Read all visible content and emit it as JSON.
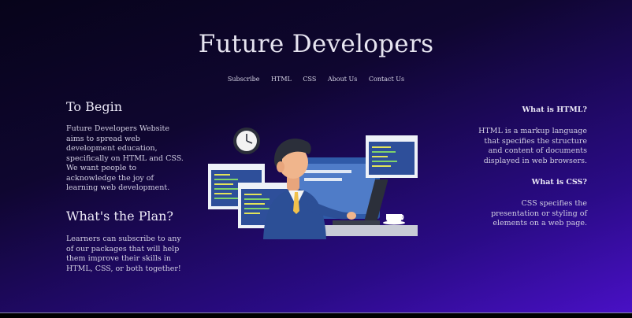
{
  "header": {
    "title": "Future Developers"
  },
  "nav": {
    "items": [
      "Subscribe",
      "HTML",
      "CSS",
      "About Us",
      "Contact Us"
    ]
  },
  "left": {
    "begin_heading": "To Begin",
    "begin_text": "Future Developers Website aims to spread web development education, specifically on HTML and CSS. We want people to acknowledge the joy of learning web development.",
    "plan_heading": "What's the Plan?",
    "plan_text": "Learners can subscribe to any of our packages that will help them improve their skills in HTML, CSS, or both together!"
  },
  "right": {
    "html_heading": "What is HTML?",
    "html_text": "HTML is a markup language that specifies the structure and content of documents displayed in web browsers.",
    "css_heading": "What is CSS?",
    "css_text": "CSS specifies the presentation or styling of elements on a web page."
  },
  "colors": {
    "accent": "#4a10c8",
    "background_dark": "#07041a"
  }
}
